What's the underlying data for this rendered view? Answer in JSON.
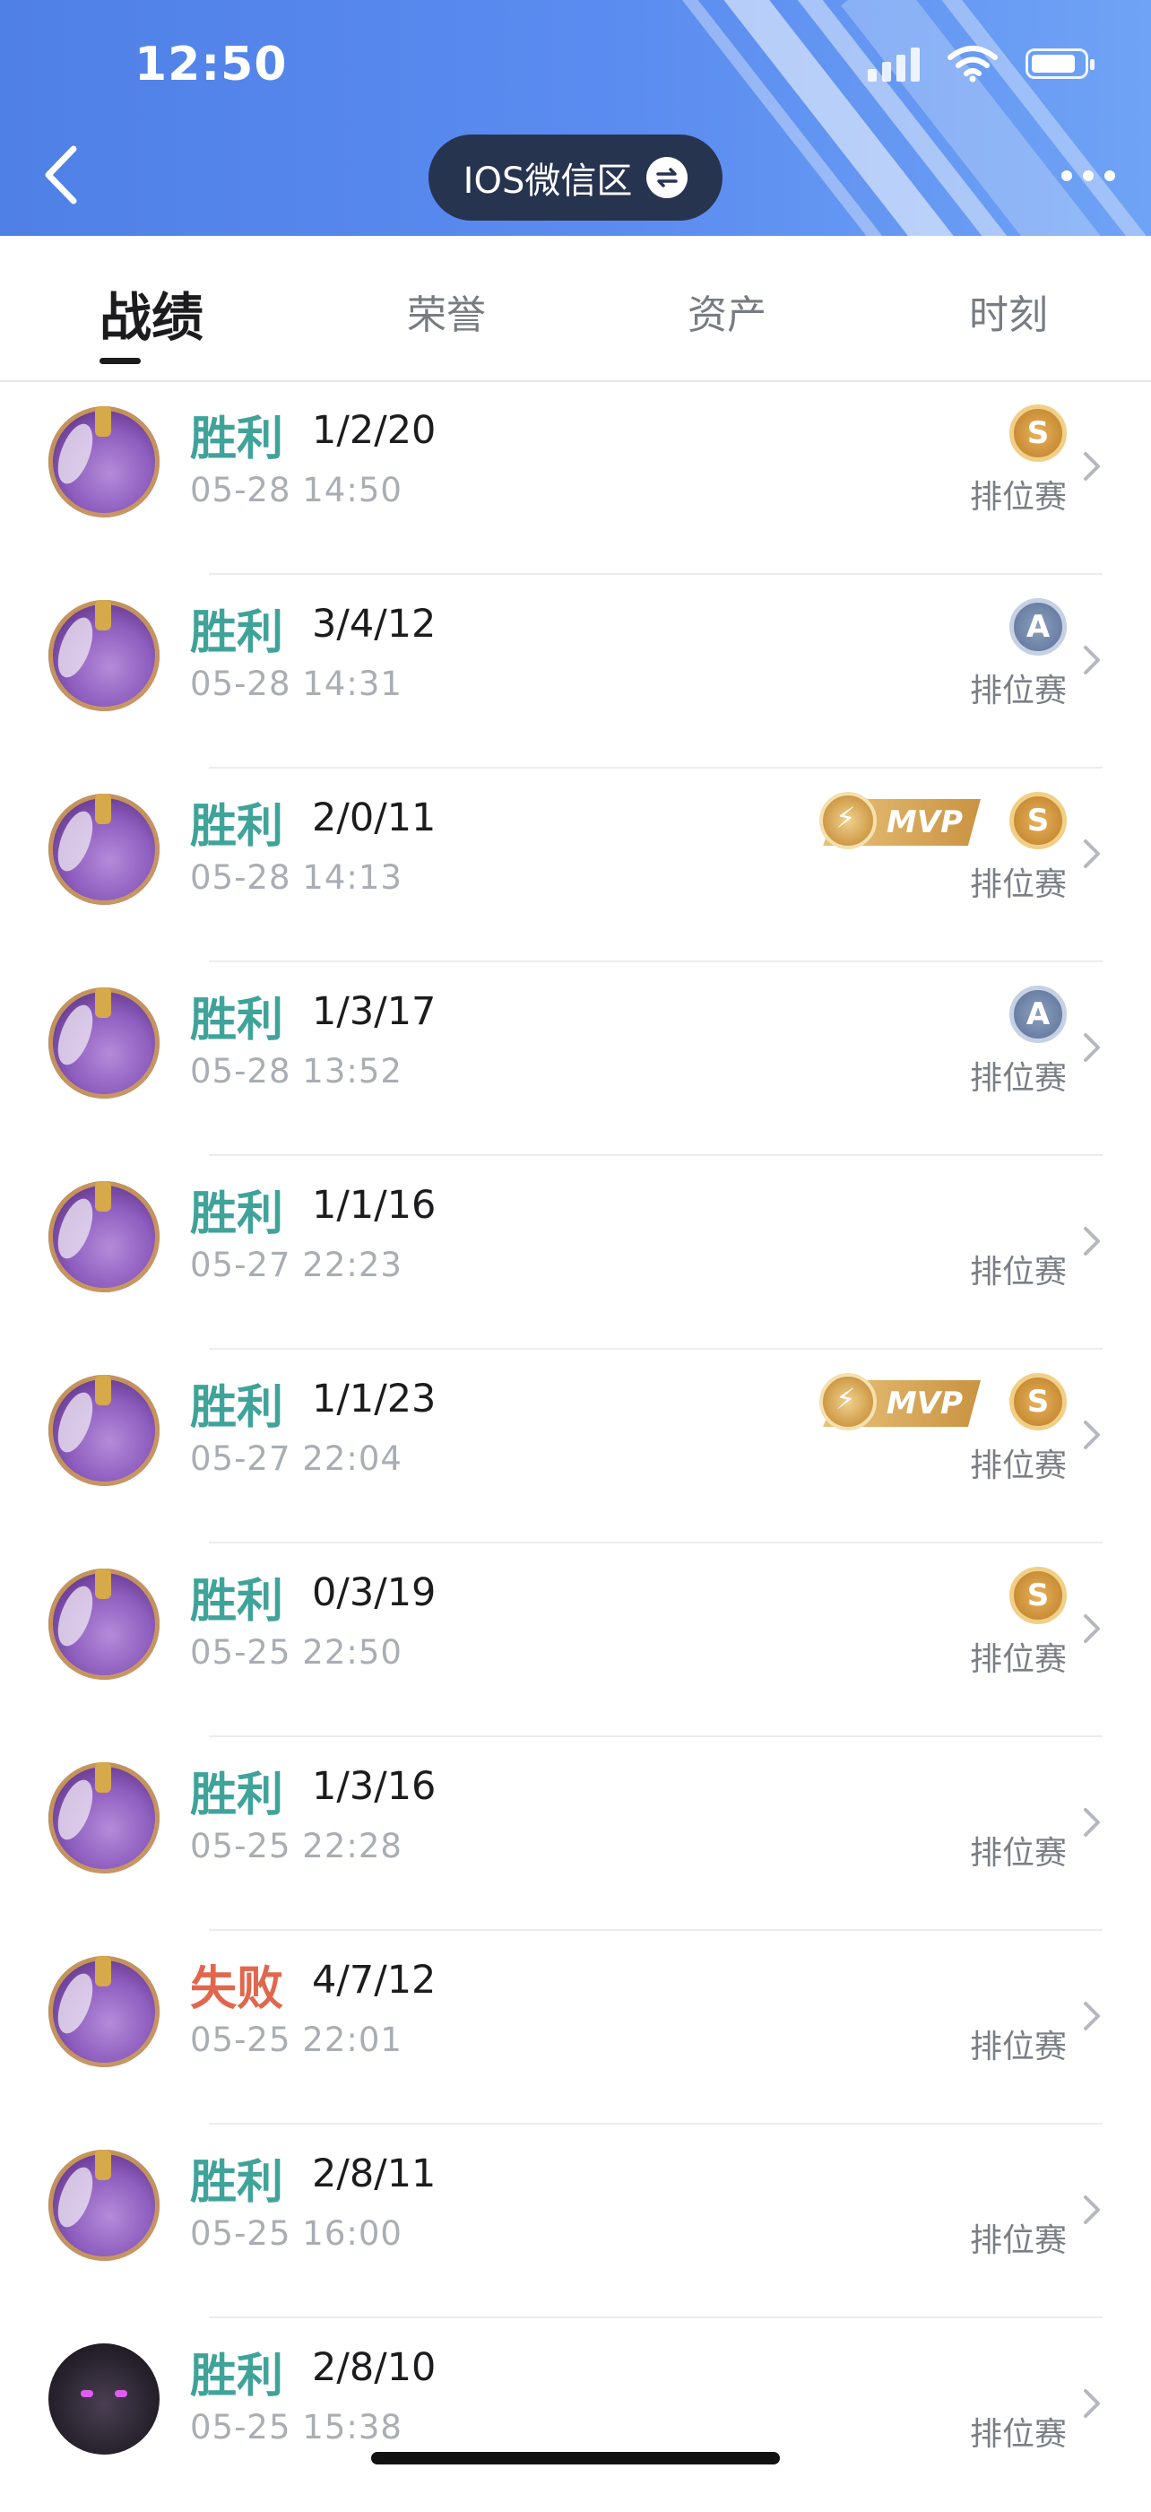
{
  "status_bar": {
    "time": "12:50"
  },
  "header": {
    "region_label": "IOS微信区"
  },
  "tabs": [
    {
      "label": "战绩",
      "active": true
    },
    {
      "label": "荣誉",
      "active": false
    },
    {
      "label": "资产",
      "active": false
    },
    {
      "label": "时刻",
      "active": false
    }
  ],
  "colors": {
    "win": "#3fa39a",
    "loss": "#e0674e",
    "header_blue": "#5b8cf0"
  },
  "matches": [
    {
      "result": "胜利",
      "win": true,
      "score": "1/2/20",
      "time": "05-28 14:50",
      "mode": "排位赛",
      "rank_badge": "S",
      "mvp": false,
      "mvp_label": ""
    },
    {
      "result": "胜利",
      "win": true,
      "score": "3/4/12",
      "time": "05-28 14:31",
      "mode": "排位赛",
      "rank_badge": "A",
      "mvp": false,
      "mvp_label": ""
    },
    {
      "result": "胜利",
      "win": true,
      "score": "2/0/11",
      "time": "05-28 14:13",
      "mode": "排位赛",
      "rank_badge": "S",
      "mvp": true,
      "mvp_label": "MVP"
    },
    {
      "result": "胜利",
      "win": true,
      "score": "1/3/17",
      "time": "05-28 13:52",
      "mode": "排位赛",
      "rank_badge": "A",
      "mvp": false,
      "mvp_label": ""
    },
    {
      "result": "胜利",
      "win": true,
      "score": "1/1/16",
      "time": "05-27 22:23",
      "mode": "排位赛",
      "rank_badge": "",
      "mvp": false,
      "mvp_label": ""
    },
    {
      "result": "胜利",
      "win": true,
      "score": "1/1/23",
      "time": "05-27 22:04",
      "mode": "排位赛",
      "rank_badge": "S",
      "mvp": true,
      "mvp_label": "MVP"
    },
    {
      "result": "胜利",
      "win": true,
      "score": "0/3/19",
      "time": "05-25 22:50",
      "mode": "排位赛",
      "rank_badge": "S",
      "mvp": false,
      "mvp_label": ""
    },
    {
      "result": "胜利",
      "win": true,
      "score": "1/3/16",
      "time": "05-25 22:28",
      "mode": "排位赛",
      "rank_badge": "",
      "mvp": false,
      "mvp_label": ""
    },
    {
      "result": "失败",
      "win": false,
      "score": "4/7/12",
      "time": "05-25 22:01",
      "mode": "排位赛",
      "rank_badge": "",
      "mvp": false,
      "mvp_label": ""
    },
    {
      "result": "胜利",
      "win": true,
      "score": "2/8/11",
      "time": "05-25 16:00",
      "mode": "排位赛",
      "rank_badge": "",
      "mvp": false,
      "mvp_label": ""
    },
    {
      "result": "胜利",
      "win": true,
      "score": "2/8/10",
      "time": "05-25 15:38",
      "mode": "排位赛",
      "rank_badge": "",
      "mvp": false,
      "mvp_label": "",
      "avatar_variant": "dark"
    }
  ]
}
